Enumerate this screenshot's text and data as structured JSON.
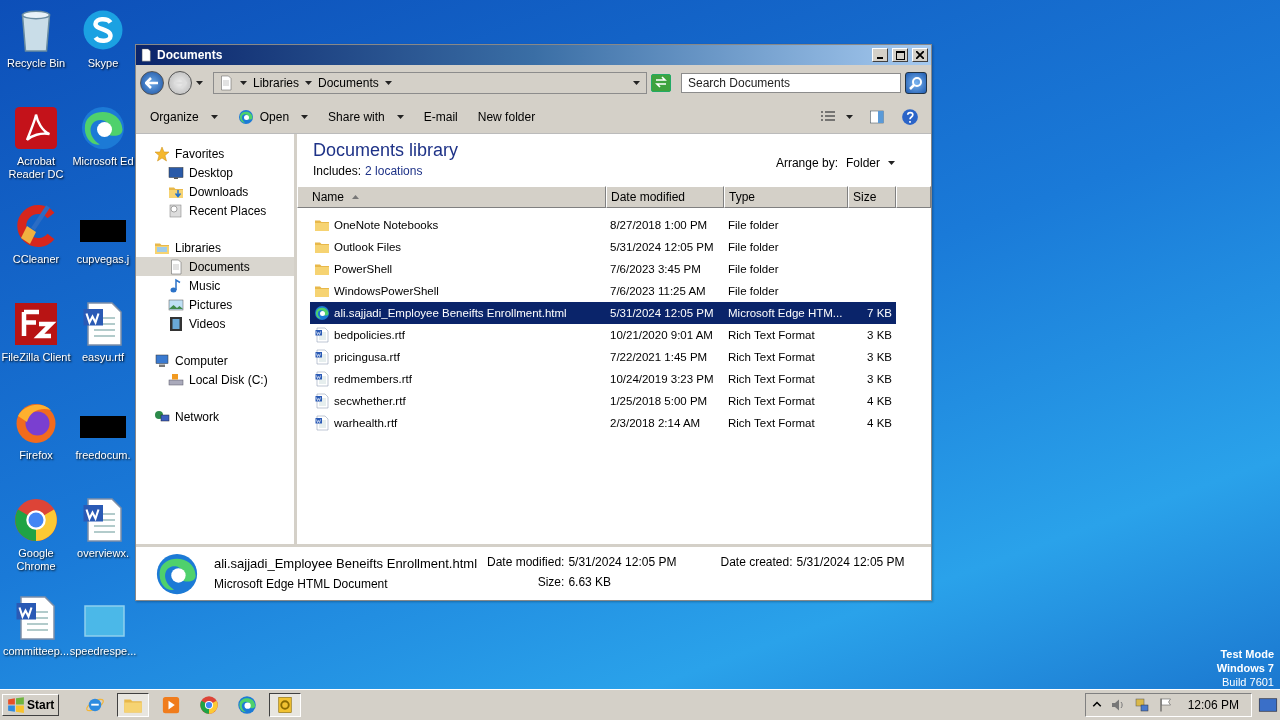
{
  "desktop": {
    "icons": [
      {
        "label": "Recycle Bin",
        "kind": "recycle"
      },
      {
        "label": "Acrobat Reader DC",
        "kind": "pdf"
      },
      {
        "label": "CCleaner",
        "kind": "cleaner"
      },
      {
        "label": "FileZilla Client",
        "kind": "ftp"
      },
      {
        "label": "Firefox",
        "kind": "firefox"
      },
      {
        "label": "Google Chrome",
        "kind": "chrome"
      },
      {
        "label": "committeep...",
        "kind": "word"
      },
      {
        "label": "Skype",
        "kind": "skype"
      },
      {
        "label": "Microsoft Ed",
        "kind": "edge"
      },
      {
        "label": "cupvegas.j",
        "kind": "redacted"
      },
      {
        "label": "easyu.rtf",
        "kind": "word"
      },
      {
        "label": "freedocum.",
        "kind": "redacted"
      },
      {
        "label": "overviewx.",
        "kind": "word"
      },
      {
        "label": "speedrespe...",
        "kind": "blank"
      }
    ],
    "notice": [
      "Test Mode",
      "Windows 7",
      "Build 7601"
    ]
  },
  "window": {
    "title": "Documents",
    "breadcrumb": [
      "Libraries",
      "Documents"
    ],
    "search": {
      "placeholder": "Search Documents"
    },
    "toolbar": [
      {
        "label": "Organize",
        "kind": "menu"
      },
      {
        "label": "Open",
        "kind": "open"
      },
      {
        "label": "Share with",
        "kind": "menu"
      },
      {
        "label": "E-mail",
        "kind": "plain"
      },
      {
        "label": "New folder",
        "kind": "plain"
      }
    ],
    "nav": [
      {
        "label": "Favorites",
        "kind": "star",
        "selected": false,
        "children": [
          {
            "label": "Desktop",
            "kind": "desktop",
            "selected": false
          },
          {
            "label": "Downloads",
            "kind": "downloads",
            "selected": false
          },
          {
            "label": "Recent Places",
            "kind": "recent",
            "selected": false
          }
        ]
      },
      {
        "label": "Libraries",
        "kind": "library",
        "selected": false,
        "children": [
          {
            "label": "Documents",
            "kind": "doclib",
            "selected": true
          },
          {
            "label": "Music",
            "kind": "music",
            "selected": false
          },
          {
            "label": "Pictures",
            "kind": "pictures",
            "selected": false
          },
          {
            "label": "Videos",
            "kind": "videos",
            "selected": false
          }
        ]
      },
      {
        "label": "Computer",
        "kind": "computer",
        "selected": false,
        "children": [
          {
            "label": "Local Disk (C:)",
            "kind": "disk",
            "selected": false
          }
        ]
      },
      {
        "label": "Network",
        "kind": "network",
        "selected": false
      }
    ],
    "library": {
      "title": "Documents library",
      "includes_label": "Includes:",
      "includes_link": "2 locations",
      "arrange_label": "Arrange by:",
      "arrange_value": "Folder"
    },
    "columns": [
      "Name",
      "Date modified",
      "Type",
      "Size"
    ],
    "rows": [
      {
        "name": "OneNote Notebooks",
        "date": "8/27/2018 1:00 PM",
        "type": "File folder",
        "size": "",
        "kind": "folder",
        "selected": false
      },
      {
        "name": "Outlook Files",
        "date": "5/31/2024 12:05 PM",
        "type": "File folder",
        "kind": "folder",
        "selected": false
      },
      {
        "name": "PowerShell",
        "date": "7/6/2023 3:45 PM",
        "type": "File folder",
        "kind": "folder",
        "selected": false
      },
      {
        "name": "WindowsPowerShell",
        "date": "7/6/2023 11:25 AM",
        "type": "File folder",
        "kind": "folder",
        "selected": false
      },
      {
        "name": "ali.sajjadi_Employee Beneifts Enrollment.html",
        "date": "5/31/2024 12:05 PM",
        "type": "Microsoft Edge HTM...",
        "size": "7 KB",
        "kind": "edge",
        "selected": true
      },
      {
        "name": "bedpolicies.rtf",
        "date": "10/21/2020 9:01 AM",
        "type": "Rich Text Format",
        "size": "3 KB",
        "kind": "word",
        "selected": false
      },
      {
        "name": "pricingusa.rtf",
        "date": "7/22/2021 1:45 PM",
        "type": "Rich Text Format",
        "size": "3 KB",
        "kind": "word",
        "selected": false
      },
      {
        "name": "redmembers.rtf",
        "date": "10/24/2019 3:23 PM",
        "type": "Rich Text Format",
        "size": "3 KB",
        "kind": "word",
        "selected": false
      },
      {
        "name": "secwhether.rtf",
        "date": "1/25/2018 5:00 PM",
        "type": "Rich Text Format",
        "size": "4 KB",
        "kind": "word",
        "selected": false
      },
      {
        "name": "warhealth.rtf",
        "date": "2/3/2018 2:14 AM",
        "type": "Rich Text Format",
        "size": "4 KB",
        "kind": "word",
        "selected": false
      }
    ],
    "details": {
      "name": "ali.sajjadi_Employee Beneifts Enrollment.html",
      "type": "Microsoft Edge HTML Document",
      "groups": [
        [
          {
            "label": "Date modified:",
            "value": "5/31/2024 12:05 PM"
          },
          {
            "label": "Size:",
            "value": "6.63 KB"
          }
        ],
        [
          {
            "label": "Date created:",
            "value": "5/31/2024 12:05 PM"
          }
        ]
      ]
    }
  },
  "taskbar": {
    "start": "Start",
    "apps": [
      {
        "kind": "ie",
        "active": false
      },
      {
        "kind": "explorer",
        "active": true
      },
      {
        "kind": "media",
        "active": false
      },
      {
        "kind": "chrome",
        "active": false
      },
      {
        "kind": "edge",
        "active": false
      },
      {
        "kind": "outlook",
        "active": true
      }
    ],
    "clock": "12:06 PM"
  }
}
